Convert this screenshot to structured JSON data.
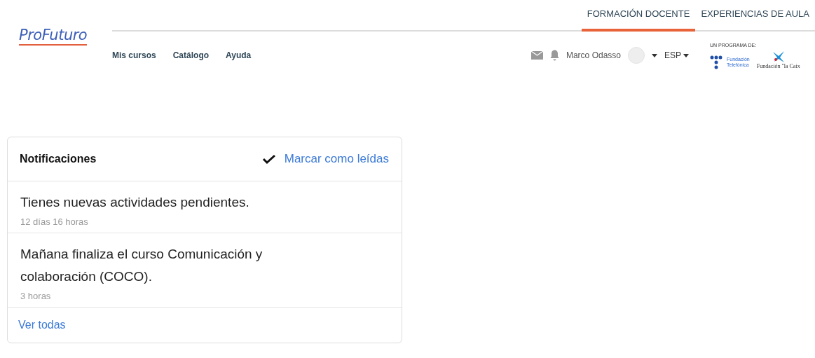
{
  "logo": {
    "text": "ProFuturo"
  },
  "top_tabs": [
    {
      "label": "FORMACIÓN DOCENTE",
      "selected": true
    },
    {
      "label": "EXPERIENCIAS DE AULA",
      "selected": false
    }
  ],
  "nav": [
    "Mis cursos",
    "Catálogo",
    "Ayuda"
  ],
  "user": {
    "name": "Marco Odasso",
    "language": "ESP"
  },
  "sponsors": {
    "caption": "UN PROGRAMA DE:",
    "telefonica": "Fundación\nTelefónica",
    "caixa": "Fundación \"la Caix"
  },
  "notifications": {
    "title": "Notificaciones",
    "mark_read": "Marcar como leídas",
    "items": [
      {
        "text": "Tienes nuevas actividades pendientes.",
        "time": "12 días 16 horas"
      },
      {
        "text": "Mañana finaliza el curso Comunicación y colaboración (COCO).",
        "time": "3 horas"
      }
    ],
    "see_all": "Ver todas"
  }
}
